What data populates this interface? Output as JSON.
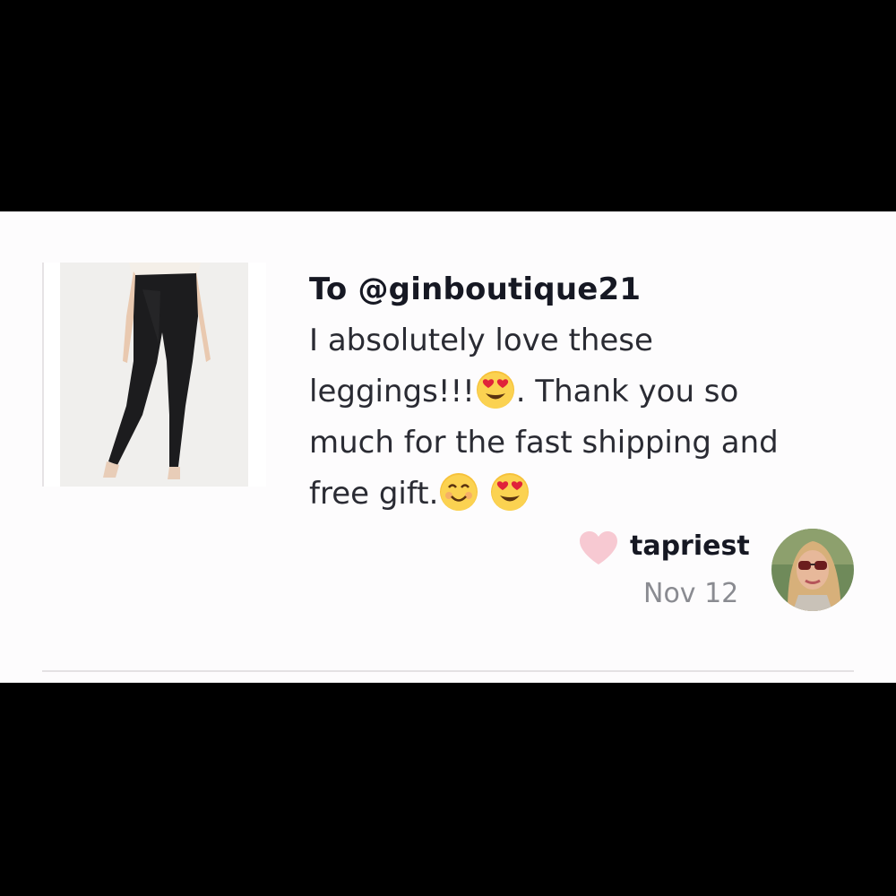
{
  "comment": {
    "recipient": "To @ginboutique21",
    "line1": "I absolutely love these",
    "line2a": "leggings!!!",
    "line2b": ". Thank you so",
    "line3": "much for the fast shipping and",
    "line4": "free gift."
  },
  "author": {
    "username": "tapriest",
    "date": "Nov 12",
    "avatar_icon": "avatar-photo"
  },
  "icons": {
    "like": "heart-icon",
    "emoji_love": "heart-eyes-emoji",
    "emoji_smile": "smiling-emoji"
  },
  "colors": {
    "heart": "#f7c9d2",
    "text_primary": "#161823",
    "text_secondary": "#8a8b91"
  }
}
